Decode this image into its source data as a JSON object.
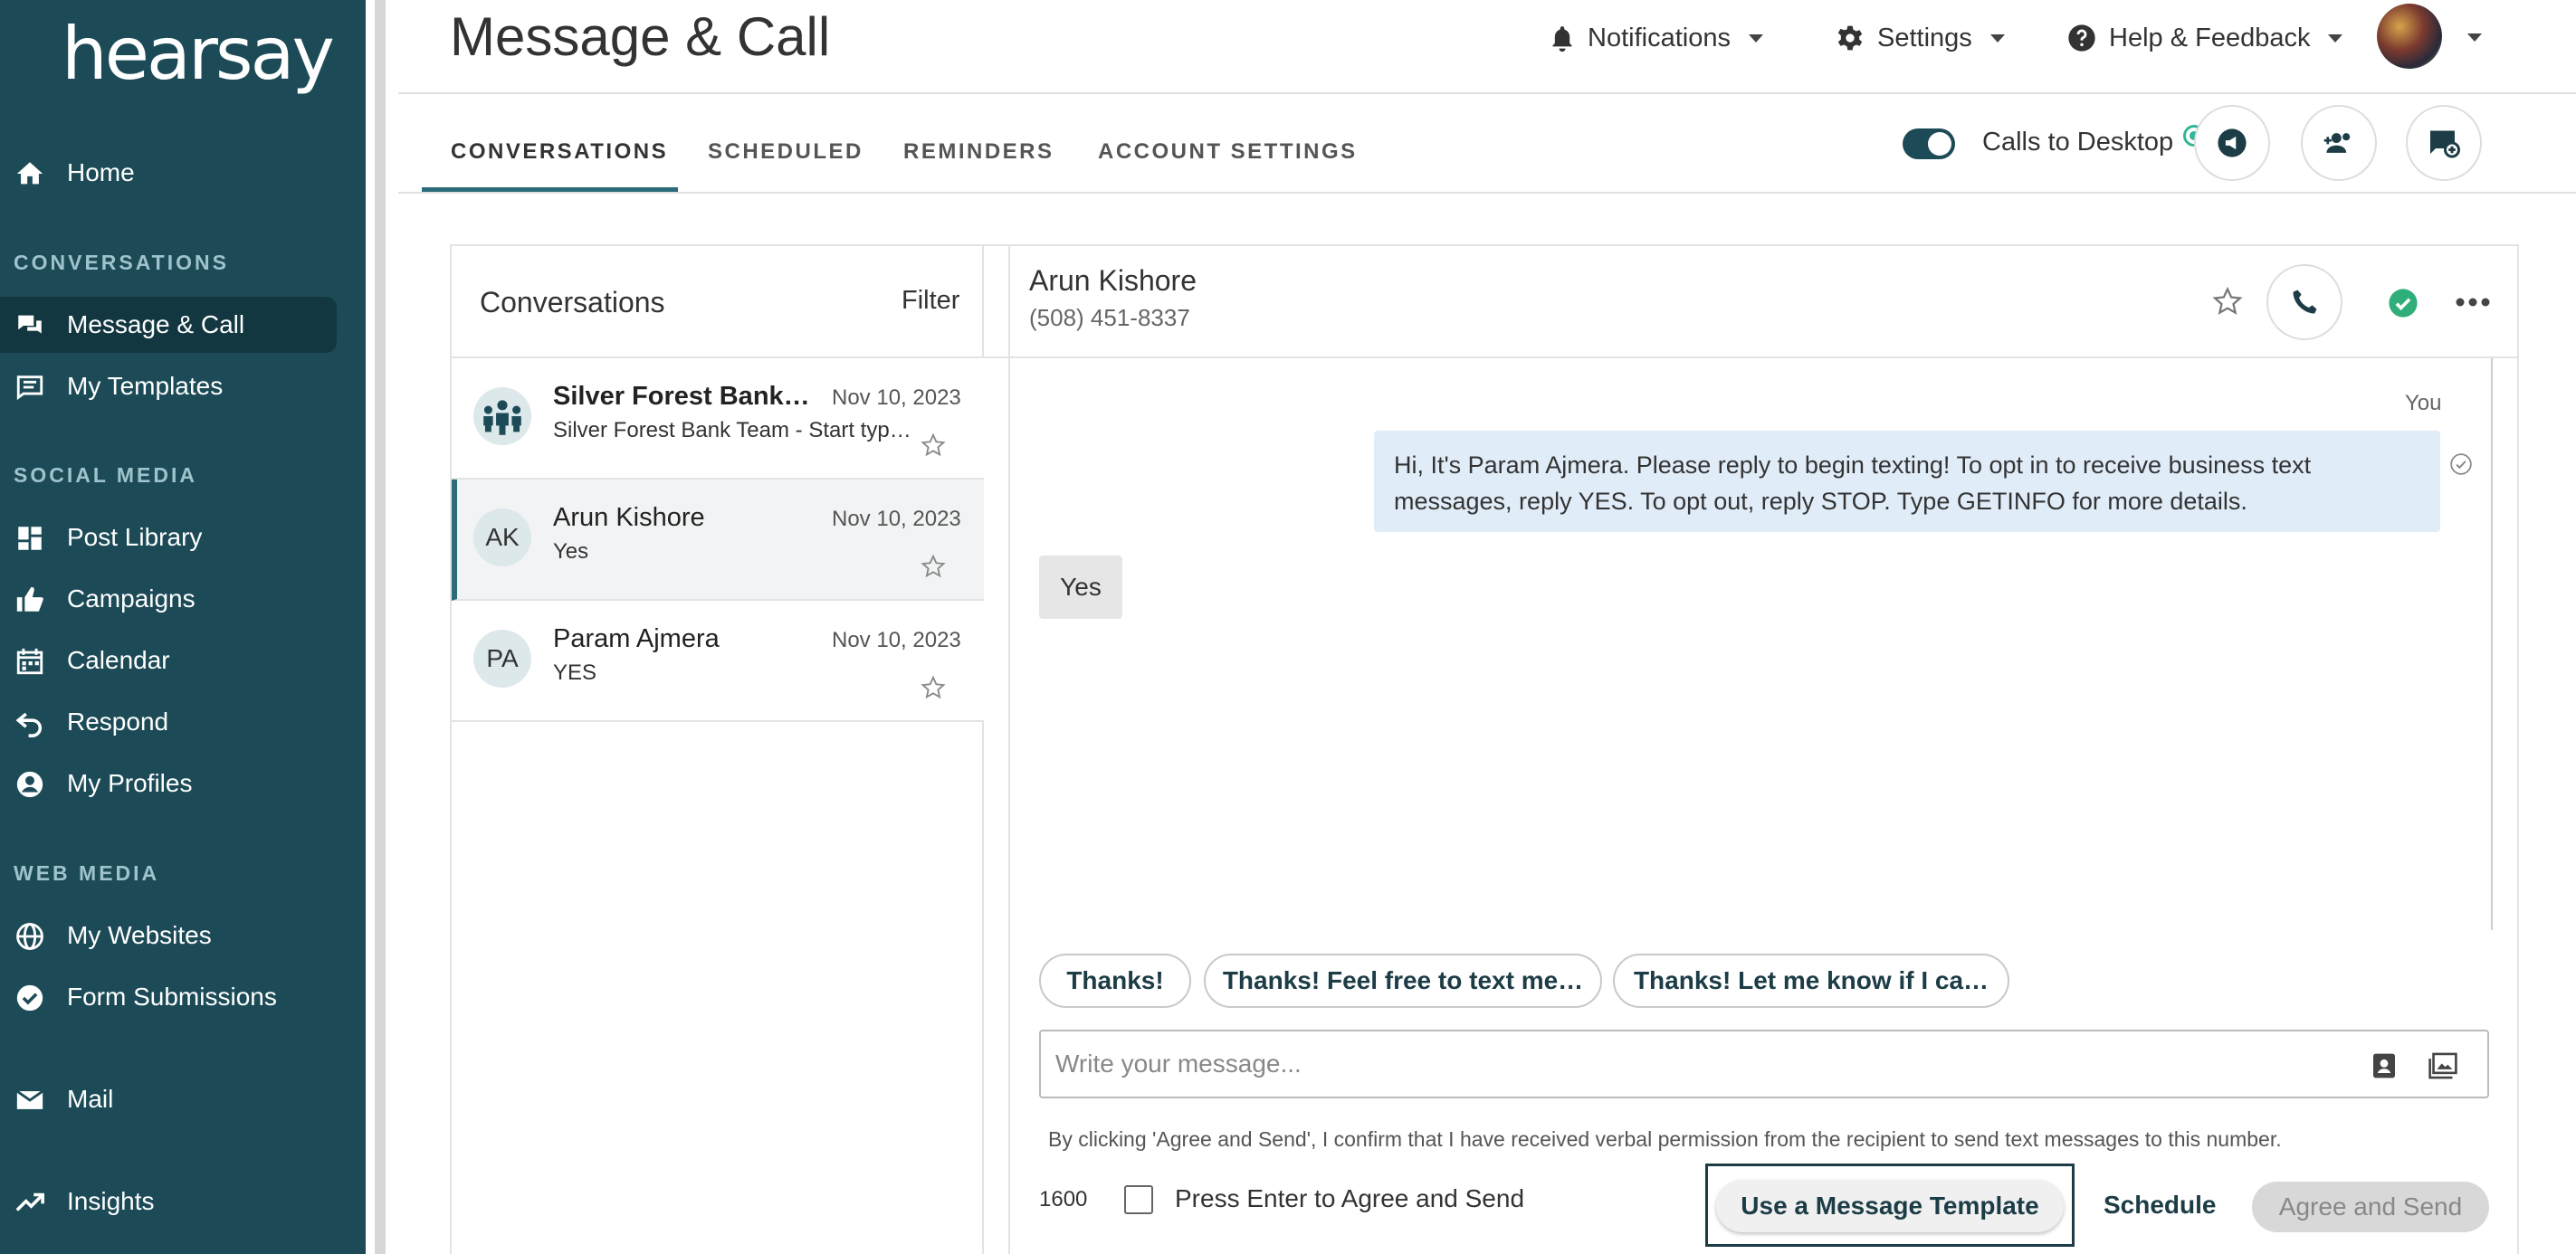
{
  "sidebar": {
    "logo": "hearsay",
    "home_label": "Home",
    "sections": {
      "conversations": "CONVERSATIONS",
      "social_media": "SOCIAL MEDIA",
      "web_media": "WEB MEDIA"
    },
    "items": {
      "message_call": "Message & Call",
      "my_templates": "My Templates",
      "post_library": "Post Library",
      "campaigns": "Campaigns",
      "calendar": "Calendar",
      "respond": "Respond",
      "my_profiles": "My Profiles",
      "my_websites": "My Websites",
      "form_submissions": "Form Submissions",
      "mail": "Mail",
      "insights": "Insights"
    },
    "active_item": "message_call",
    "colors": {
      "background": "#1c4b57",
      "active": "#133740"
    }
  },
  "header": {
    "title": "Message & Call",
    "notifications": "Notifications",
    "settings": "Settings",
    "help": "Help & Feedback"
  },
  "tabs": {
    "conversations": "CONVERSATIONS",
    "scheduled": "SCHEDULED",
    "reminders": "REMINDERS",
    "account_settings": "ACCOUNT SETTINGS",
    "active": "conversations"
  },
  "calls_to_desktop": {
    "label": "Calls to Desktop",
    "enabled": true
  },
  "conversation_list": {
    "title": "Conversations",
    "filter_label": "Filter",
    "items": [
      {
        "name": "Silver Forest Bank Team",
        "snippet": "Silver Forest Bank Team - Start typing",
        "date": "Nov 10, 2023",
        "avatar_icon": "group-icon",
        "active": false
      },
      {
        "name": "Arun Kishore",
        "snippet": "Yes",
        "date": "Nov 10, 2023",
        "initials": "AK",
        "active": true
      },
      {
        "name": "Param Ajmera",
        "snippet": "YES",
        "date": "Nov 10, 2023",
        "initials": "PA",
        "active": false
      }
    ]
  },
  "chat": {
    "contact_name": "Arun Kishore",
    "contact_phone": "(508) 451-8337",
    "sender_label": "You",
    "messages": [
      {
        "direction": "outgoing",
        "text": "Hi, It's Param Ajmera. Please reply to begin texting! To opt in to receive business text messages, reply YES. To opt out, reply STOP. Type GETINFO for more details."
      },
      {
        "direction": "incoming",
        "text": "Yes"
      }
    ],
    "quick_replies": [
      "Thanks!",
      "Thanks! Feel free to text me…",
      "Thanks! Let me know if I ca…"
    ],
    "input_placeholder": "Write your message...",
    "input_value": "",
    "consent_text": "By clicking 'Agree and Send', I confirm that I have received verbal permission from the recipient to send text messages to this number.",
    "char_count": "1600",
    "enter_to_send_label": "Press Enter to Agree and Send",
    "enter_to_send_checked": false,
    "template_button": "Use a Message Template",
    "schedule_button": "Schedule",
    "send_button": "Agree and Send"
  }
}
